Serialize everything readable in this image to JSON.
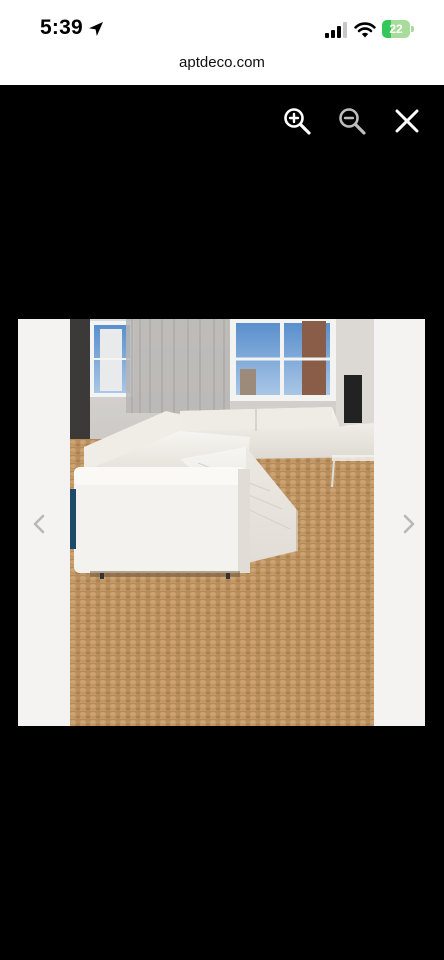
{
  "status_bar": {
    "time": "5:39",
    "battery_level": "22",
    "battery_color": "#34c759",
    "icons": [
      "location-arrow-icon",
      "cellular-signal-icon",
      "wifi-icon",
      "battery-icon"
    ]
  },
  "browser": {
    "url": "aptdeco.com"
  },
  "viewer": {
    "controls": [
      "zoom-in-icon",
      "zoom-out-icon",
      "close-icon"
    ],
    "navigation": [
      "chevron-left-icon",
      "chevron-right-icon"
    ],
    "image_subject": "white leather sectional sofa on shag rug"
  },
  "colors": {
    "background": "#000000",
    "stage": "#f5f3f1",
    "controls": "#ffffff"
  }
}
